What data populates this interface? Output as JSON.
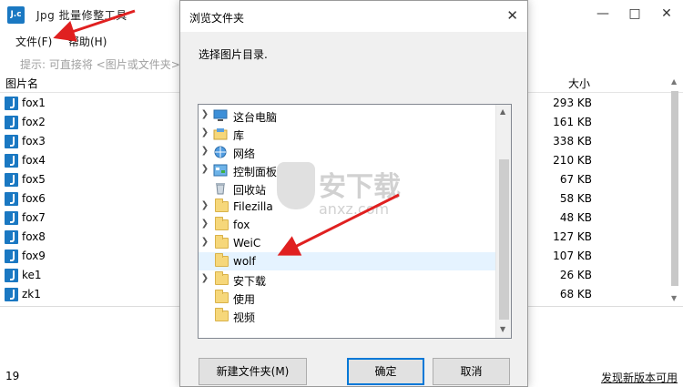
{
  "app": {
    "logo_text": "J.c",
    "title": "Jpg 批量修整工具",
    "menu": [
      "文件(F)",
      "帮助(H)"
    ],
    "hint": "提示: 可直接将 <图片或文件夹>",
    "columns": {
      "name": "图片名",
      "size": "大小"
    },
    "files": [
      {
        "name": "fox1",
        "size": "293 KB"
      },
      {
        "name": "fox2",
        "size": "161 KB"
      },
      {
        "name": "fox3",
        "size": "338 KB"
      },
      {
        "name": "fox4",
        "size": "210 KB"
      },
      {
        "name": "fox5",
        "size": "67 KB"
      },
      {
        "name": "fox6",
        "size": "58 KB"
      },
      {
        "name": "fox7",
        "size": "48 KB"
      },
      {
        "name": "fox8",
        "size": "127 KB"
      },
      {
        "name": "fox9",
        "size": "107 KB"
      },
      {
        "name": "ke1",
        "size": "26 KB"
      },
      {
        "name": "zk1",
        "size": "68 KB"
      }
    ],
    "status_count": "19",
    "status_update": "发现新版本可用"
  },
  "dialog": {
    "title": "浏览文件夹",
    "close": "✕",
    "prompt": "选择图片目录.",
    "tree": [
      {
        "label": "这台电脑",
        "icon": "computer-icon",
        "expandable": true
      },
      {
        "label": "库",
        "icon": "library-icon",
        "expandable": true
      },
      {
        "label": "网络",
        "icon": "network-icon",
        "expandable": true
      },
      {
        "label": "控制面板",
        "icon": "control-panel-icon",
        "expandable": true
      },
      {
        "label": "回收站",
        "icon": "recycle-bin-icon",
        "expandable": false
      },
      {
        "label": "Filezilla",
        "icon": "folder-icon",
        "expandable": true
      },
      {
        "label": "fox",
        "icon": "folder-icon",
        "expandable": true
      },
      {
        "label": "WeiC",
        "icon": "folder-icon",
        "expandable": true
      },
      {
        "label": "wolf",
        "icon": "folder-icon",
        "expandable": false,
        "selected": true
      },
      {
        "label": "安下载",
        "icon": "folder-icon",
        "expandable": true
      },
      {
        "label": "使用",
        "icon": "folder-icon",
        "expandable": false
      },
      {
        "label": "视频",
        "icon": "folder-icon",
        "expandable": false
      }
    ],
    "buttons": {
      "new_folder": "新建文件夹(M)",
      "ok": "确定",
      "cancel": "取消"
    }
  },
  "watermark": {
    "text": "安下载",
    "sub": "anxz.com"
  },
  "colors": {
    "accent": "#1a78c2",
    "selection": "#e5f3ff",
    "arrow": "#e02020"
  }
}
